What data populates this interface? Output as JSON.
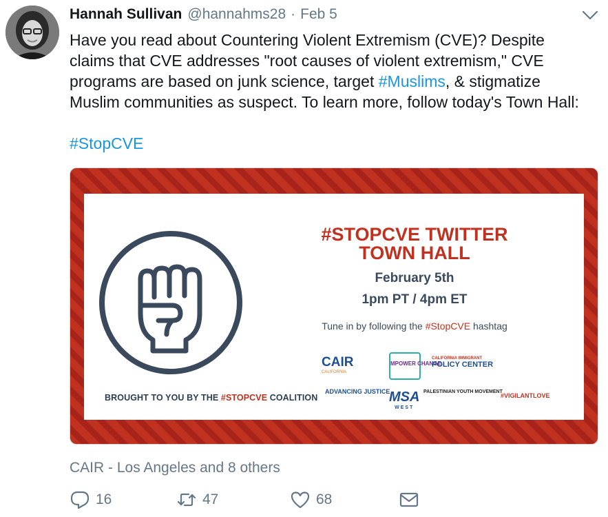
{
  "tweet": {
    "author_name": "Hannah Sullivan",
    "author_handle": "@hannahms28",
    "separator": "·",
    "date": "Feb 5",
    "text_lines": [
      "Have you read about Countering Violent Extremism (CVE)? Despite",
      "claims that CVE addresses \"root causes of violent extremism,\" CVE",
      "programs are based on junk science, target ",
      "#Muslims",
      ", & stigmatize",
      "Muslim communities as suspect. To learn more, follow today's Town Hall:"
    ],
    "hashtag_line": "#StopCVE"
  },
  "card": {
    "title_line1": "#STOPCVE TWITTER",
    "title_line2": "TOWN HALL",
    "date": "February 5th",
    "time": "1pm PT / 4pm ET",
    "tune_prefix": "Tune in by following the ",
    "tune_hashtag": "#StopCVE",
    "tune_suffix": " hashtag",
    "brought_prefix": "BROUGHT TO YOU BY THE ",
    "brought_hashtag": "#STOPCVE",
    "brought_suffix": " COALITION",
    "logos": {
      "cair": "CAIR",
      "cair_sub": "CALIFORNIA",
      "mpower": "MPOWER CHANGE",
      "cipc_small": "CALIFORNIA IMMIGRANT",
      "cipc": "POLICY CENTER",
      "aaj": "ADVANCING JUSTICE",
      "msa": "MSA",
      "msa_sub": "WEST",
      "pym": "PALESTINIAN YOUTH MOVEMENT",
      "vl": "#VIGILANTLOVE"
    }
  },
  "social_context": "CAIR - Los Angeles and 8 others",
  "actions": {
    "reply_count": "16",
    "retweet_count": "47",
    "like_count": "68"
  },
  "colors": {
    "accent": "#1b95e0",
    "secondary_text": "#657786",
    "card_red": "#c0321f",
    "card_navy": "#3a4a5c"
  },
  "icons": [
    "avatar",
    "chevron-down-icon",
    "fist-icon",
    "reply-icon",
    "retweet-icon",
    "like-icon",
    "direct-message-icon"
  ]
}
